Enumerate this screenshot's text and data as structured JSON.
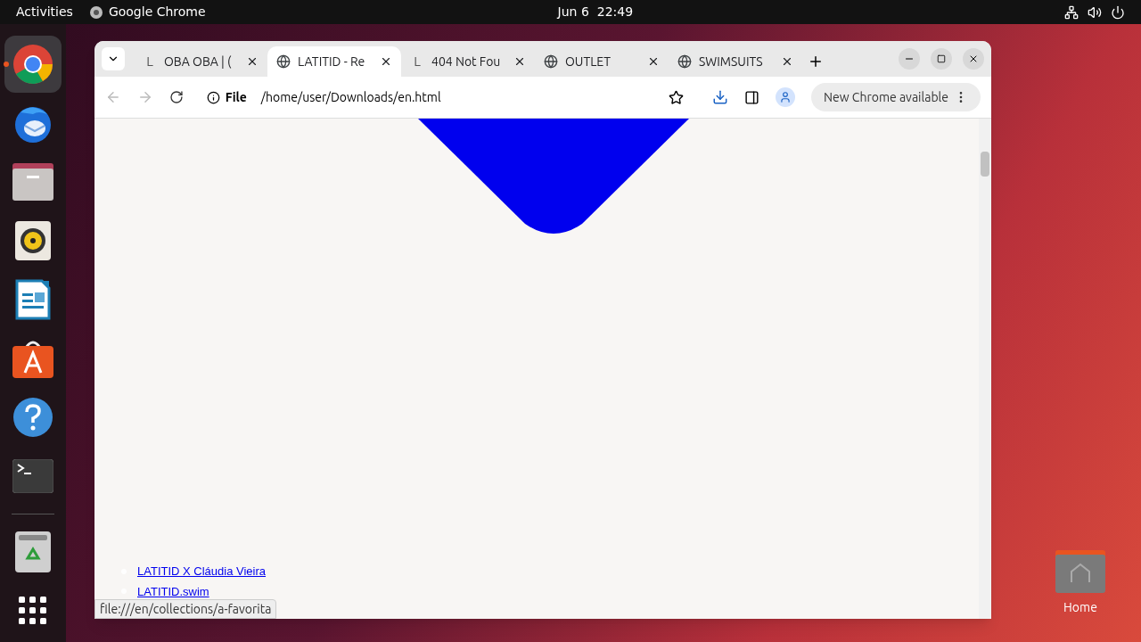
{
  "top_bar": {
    "activities": "Activities",
    "app_name": "Google Chrome",
    "clock": "Jun 6  22:49"
  },
  "dock": {
    "items": [
      {
        "kind": "chrome",
        "running": true
      },
      {
        "kind": "mail",
        "running": false
      },
      {
        "kind": "files",
        "running": false
      },
      {
        "kind": "music",
        "running": false
      },
      {
        "kind": "writer",
        "running": false
      },
      {
        "kind": "store",
        "running": false
      },
      {
        "kind": "help",
        "running": false
      },
      {
        "kind": "terminal",
        "running": false
      },
      {
        "kind": "trash",
        "running": false
      },
      {
        "kind": "apps",
        "running": false
      }
    ]
  },
  "browser": {
    "tabs": [
      {
        "title": "OBA OBA | (",
        "kind": "letter",
        "favicon_text": "L",
        "selected": false
      },
      {
        "title": "LATITID - Re",
        "kind": "globe",
        "selected": true
      },
      {
        "title": "404 Not Fou",
        "kind": "letter",
        "favicon_text": "L",
        "selected": false
      },
      {
        "title": "OUTLET",
        "kind": "globe",
        "selected": false
      },
      {
        "title": "SWIMSUITS",
        "kind": "globe",
        "selected": false
      }
    ],
    "address": {
      "scheme_label": "File",
      "url": "/home/user/Downloads/en.html"
    },
    "update_button": "New Chrome available",
    "page": {
      "links": [
        "LATITID X Cláudia Vieira",
        "LATITID.swim"
      ]
    },
    "status_url": "file:///en/collections/a-favorita"
  },
  "desktop": {
    "icons": [
      {
        "label": "Home"
      }
    ]
  }
}
